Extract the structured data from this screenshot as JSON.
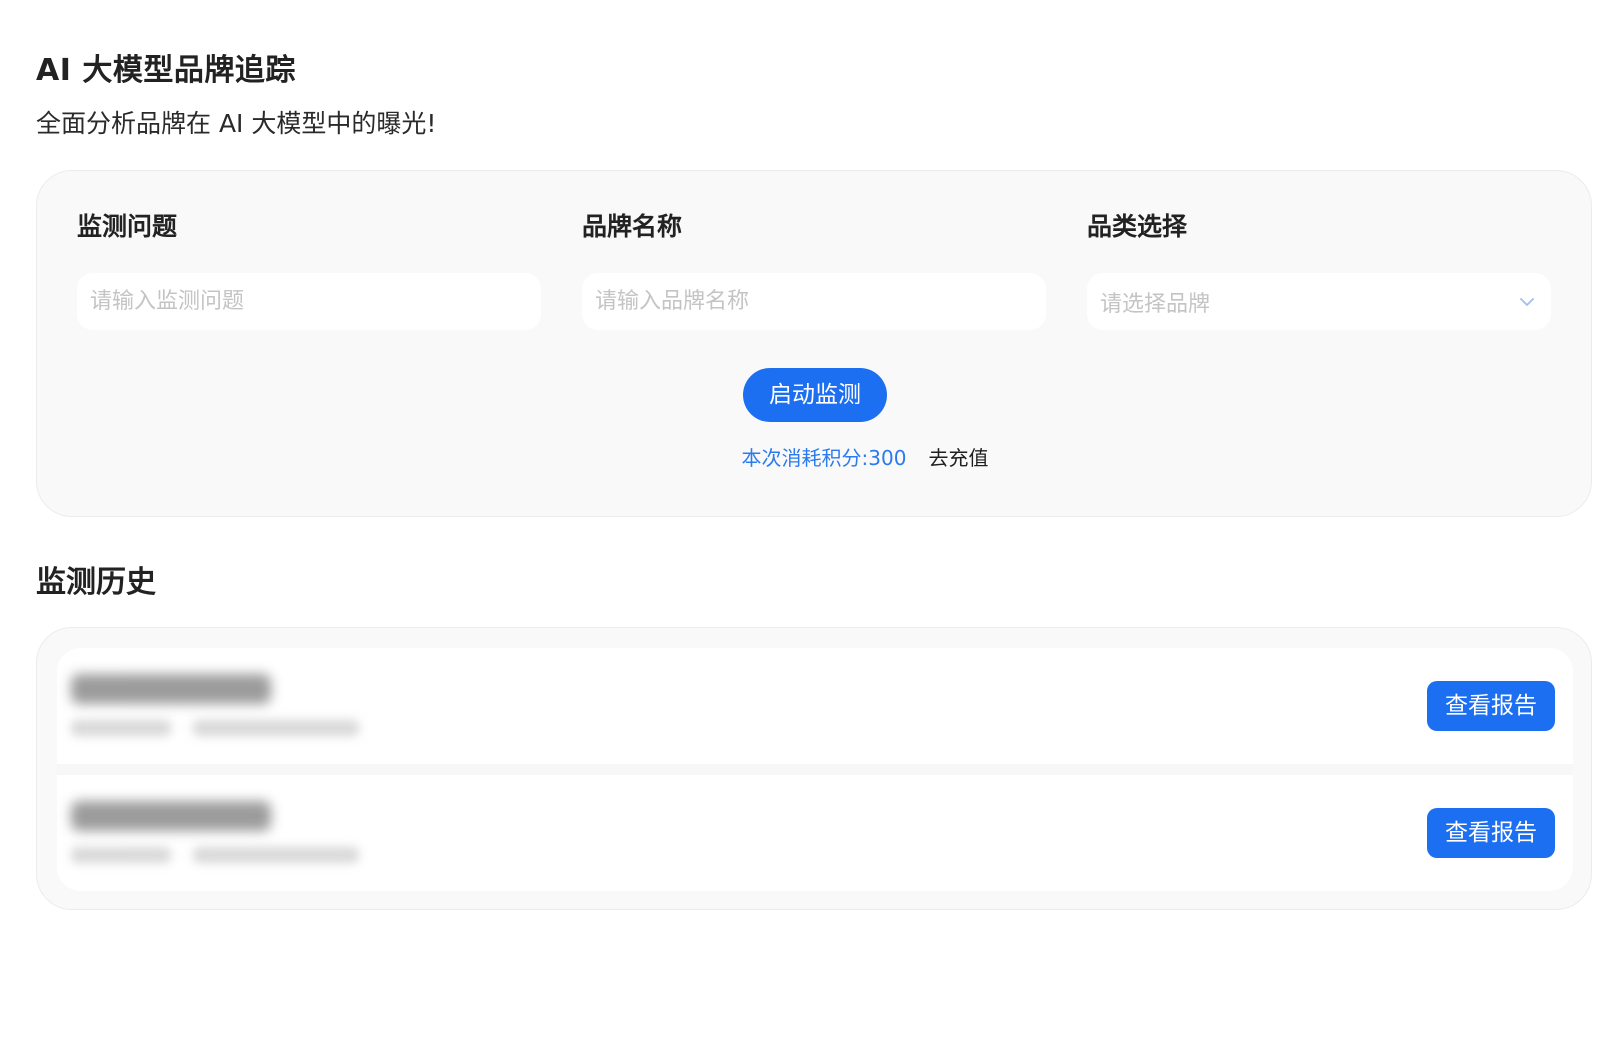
{
  "header": {
    "title": "AI 大模型品牌追踪",
    "subtitle": "全面分析品牌在 AI 大模型中的曝光!"
  },
  "form": {
    "fields": [
      {
        "label": "监测问题",
        "placeholder": "请输入监测问题",
        "value": ""
      },
      {
        "label": "品牌名称",
        "placeholder": "请输入品牌名称",
        "value": ""
      },
      {
        "label": "品类选择",
        "placeholder": "请选择品牌",
        "selected": ""
      }
    ],
    "select_icon": "chevron-down-icon",
    "submit_label": "启动监测",
    "cost_text": "本次消耗积分:300",
    "recharge_label": "去充值"
  },
  "history": {
    "title": "监测历史",
    "rows": [
      {
        "report_label": "查看报告"
      },
      {
        "report_label": "查看报告"
      }
    ]
  },
  "colors": {
    "accent": "#1d6ff2",
    "cost_text": "#2b7bf0",
    "panel_bg": "#f9f9f9",
    "placeholder": "#c4c4c4"
  }
}
